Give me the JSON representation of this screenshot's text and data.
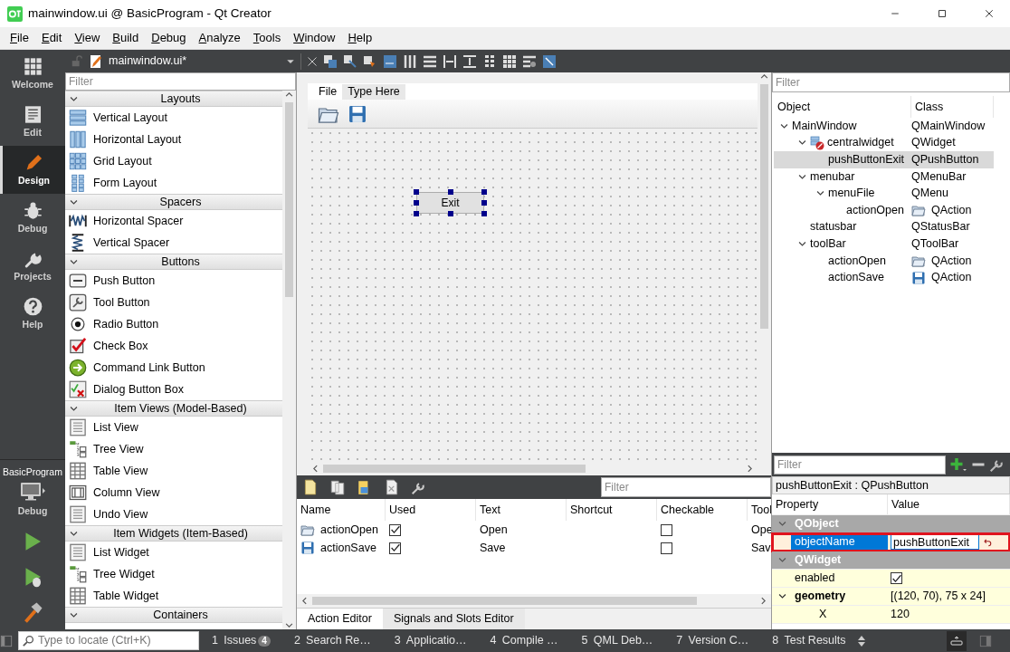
{
  "window": {
    "title": "mainwindow.ui @ BasicProgram - Qt Creator"
  },
  "menu": [
    "File",
    "Edit",
    "View",
    "Build",
    "Debug",
    "Analyze",
    "Tools",
    "Window",
    "Help"
  ],
  "editor_toolbar": {
    "document": "mainwindow.ui*"
  },
  "mode_bar": {
    "items": [
      {
        "label": "Welcome",
        "kind": "welcome",
        "selected": false
      },
      {
        "label": "Edit",
        "kind": "edit",
        "selected": false
      },
      {
        "label": "Design",
        "kind": "design",
        "selected": true
      },
      {
        "label": "Debug",
        "kind": "debug",
        "selected": false
      },
      {
        "label": "Projects",
        "kind": "projects",
        "selected": false
      },
      {
        "label": "Help",
        "kind": "help",
        "selected": false
      }
    ],
    "kit": {
      "project": "BasicProgram",
      "build": "Debug"
    }
  },
  "widget_box": {
    "filter_placeholder": "Filter",
    "categories": [
      {
        "title": "Layouts",
        "expanded": true,
        "items": [
          {
            "label": "Vertical Layout",
            "kind": "vlayout"
          },
          {
            "label": "Horizontal Layout",
            "kind": "hlayout"
          },
          {
            "label": "Grid Layout",
            "kind": "grid"
          },
          {
            "label": "Form Layout",
            "kind": "form"
          }
        ]
      },
      {
        "title": "Spacers",
        "expanded": true,
        "items": [
          {
            "label": "Horizontal Spacer",
            "kind": "hspacer"
          },
          {
            "label": "Vertical Spacer",
            "kind": "vspacer"
          }
        ]
      },
      {
        "title": "Buttons",
        "expanded": true,
        "items": [
          {
            "label": "Push Button",
            "kind": "pushbutton"
          },
          {
            "label": "Tool Button",
            "kind": "toolbutton"
          },
          {
            "label": "Radio Button",
            "kind": "radio"
          },
          {
            "label": "Check Box",
            "kind": "check"
          },
          {
            "label": "Command Link Button",
            "kind": "commandlink"
          },
          {
            "label": "Dialog Button Box",
            "kind": "dialogbox"
          }
        ]
      },
      {
        "title": "Item Views (Model-Based)",
        "expanded": true,
        "items": [
          {
            "label": "List View",
            "kind": "list"
          },
          {
            "label": "Tree View",
            "kind": "tree"
          },
          {
            "label": "Table View",
            "kind": "table"
          },
          {
            "label": "Column View",
            "kind": "column"
          },
          {
            "label": "Undo View",
            "kind": "list"
          }
        ]
      },
      {
        "title": "Item Widgets (Item-Based)",
        "expanded": true,
        "items": [
          {
            "label": "List Widget",
            "kind": "list"
          },
          {
            "label": "Tree Widget",
            "kind": "tree"
          },
          {
            "label": "Table Widget",
            "kind": "table"
          }
        ]
      },
      {
        "title": "Containers",
        "expanded": true
      }
    ]
  },
  "form": {
    "menu": [
      "File",
      "Type Here"
    ],
    "button": {
      "label": "Exit",
      "selected": true
    }
  },
  "action_editor": {
    "filter_placeholder": "Filter",
    "columns": [
      "Name",
      "Used",
      "Text",
      "Shortcut",
      "Checkable",
      "Tool"
    ],
    "rows": [
      {
        "name": "actionOpen",
        "kind": "open",
        "used": true,
        "text": "Open",
        "checkable": false,
        "tooltip": "Ope"
      },
      {
        "name": "actionSave",
        "kind": "save",
        "used": true,
        "text": "Save",
        "checkable": false,
        "tooltip": "Sav"
      }
    ],
    "tabs": [
      {
        "label": "Action Editor",
        "selected": true
      },
      {
        "label": "Signals and Slots Editor",
        "selected": false
      }
    ]
  },
  "object_inspector": {
    "filter_placeholder": "Filter",
    "columns": [
      "Object",
      "Class"
    ],
    "tree": [
      {
        "object": "MainWindow",
        "class": "QMainWindow",
        "expanded": true,
        "selected": false,
        "children": [
          {
            "object": "centralwidget",
            "class": "QWidget",
            "kind": "widget",
            "expanded": true,
            "selected": false,
            "children": [
              {
                "object": "pushButtonExit",
                "class": "QPushButton",
                "selected": true
              }
            ]
          },
          {
            "object": "menubar",
            "class": "QMenuBar",
            "expanded": true,
            "selected": false,
            "children": [
              {
                "object": "menuFile",
                "class": "QMenu",
                "expanded": true,
                "selected": false,
                "children": [
                  {
                    "object": "actionOpen",
                    "class": "QAction",
                    "kind": "open",
                    "selected": false
                  }
                ]
              }
            ]
          },
          {
            "object": "statusbar",
            "class": "QStatusBar",
            "selected": false
          },
          {
            "object": "toolBar",
            "class": "QToolBar",
            "expanded": true,
            "selected": false,
            "children": [
              {
                "object": "actionOpen",
                "class": "QAction",
                "kind": "open",
                "selected": false
              },
              {
                "object": "actionSave",
                "class": "QAction",
                "kind": "save",
                "selected": false
              }
            ]
          }
        ]
      }
    ]
  },
  "property_editor": {
    "filter_placeholder": "Filter",
    "title": "pushButtonExit : QPushButton",
    "columns": [
      "Property",
      "Value"
    ],
    "rows": [
      {
        "kind": "group",
        "name": "QObject",
        "expanded": true
      },
      {
        "kind": "text",
        "name": "objectName",
        "value": "pushButtonExit",
        "selected": true,
        "highlighted": true
      },
      {
        "kind": "group",
        "name": "QWidget",
        "expanded": true
      },
      {
        "kind": "check",
        "name": "enabled",
        "checked": true
      },
      {
        "kind": "compound",
        "name": "geometry",
        "value": "[(120, 70), 75 x 24]",
        "expanded": true
      },
      {
        "kind": "sub",
        "name": "X",
        "value": "120"
      }
    ]
  },
  "status_bar": {
    "locator_placeholder": "Type to locate (Ctrl+K)",
    "panes": [
      {
        "number": "1",
        "label": "Issues",
        "badge": "4"
      },
      {
        "number": "2",
        "label": "Search Re…"
      },
      {
        "number": "3",
        "label": "Applicatio…"
      },
      {
        "number": "4",
        "label": "Compile …"
      },
      {
        "number": "5",
        "label": "QML Deb…"
      },
      {
        "number": "7",
        "label": "Version C…"
      },
      {
        "number": "8",
        "label": "Test Results"
      }
    ]
  }
}
